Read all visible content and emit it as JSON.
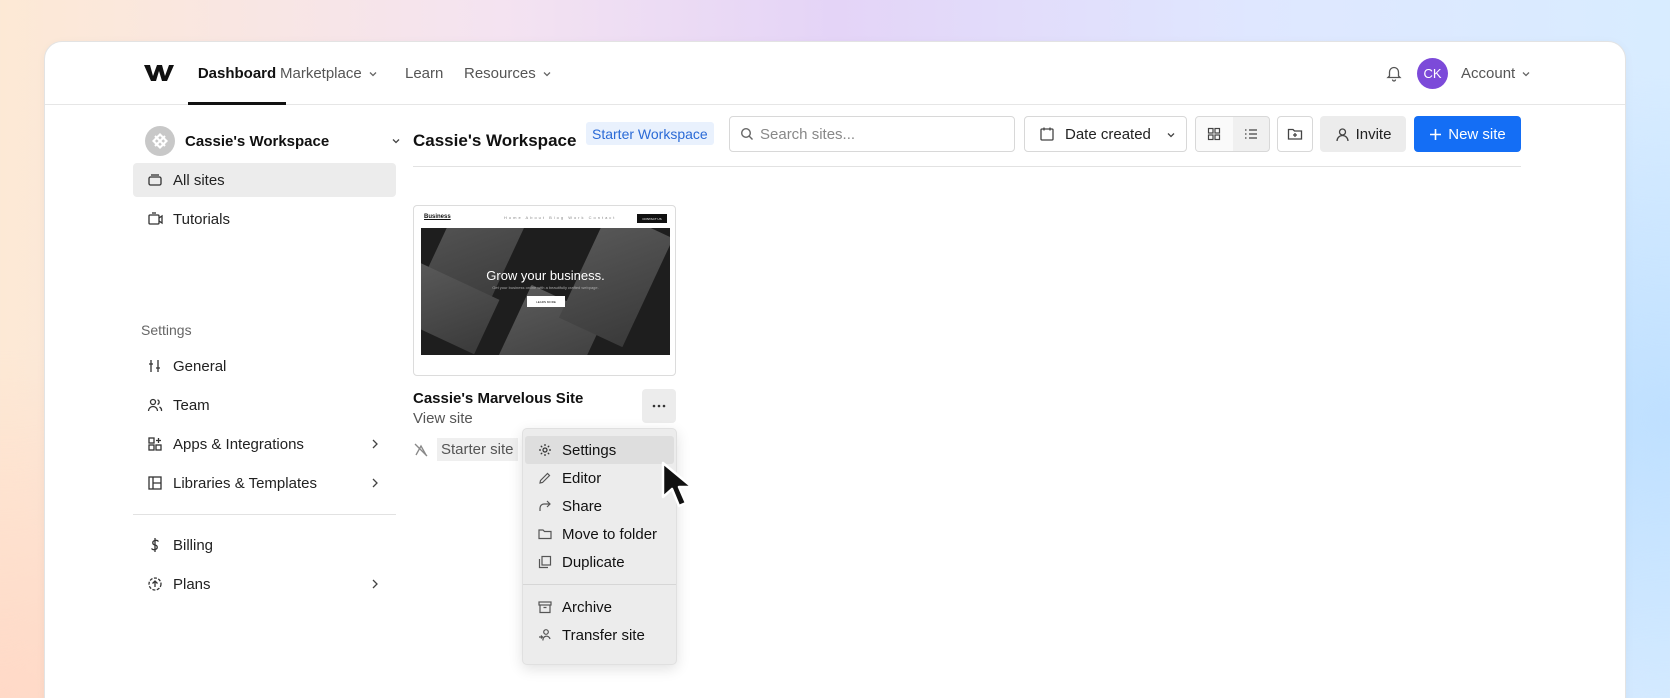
{
  "nav": {
    "dashboard": "Dashboard",
    "marketplace": "Marketplace",
    "learn": "Learn",
    "resources": "Resources",
    "avatar_initials": "CK",
    "account": "Account"
  },
  "sidebar": {
    "workspace_name": "Cassie's Workspace",
    "items": {
      "all_sites": "All sites",
      "tutorials": "Tutorials",
      "settings_heading": "Settings",
      "general": "General",
      "team": "Team",
      "apps": "Apps & Integrations",
      "libraries": "Libraries & Templates",
      "billing": "Billing",
      "plans": "Plans"
    }
  },
  "main": {
    "title": "Cassie's Workspace",
    "badge": "Starter Workspace",
    "search_placeholder": "Search sites...",
    "sort_label": "Date created",
    "invite": "Invite",
    "new_site": "New site"
  },
  "site": {
    "name": "Cassie's Marvelous Site",
    "view_site": "View site",
    "plan": "Starter site",
    "thumbnail": {
      "brand": "Business",
      "links": "Home About Blog Work Contact",
      "cta": "CONTACT US",
      "headline": "Grow your business.",
      "subtext": "Get your business online with a beautifully crafted webpage.",
      "button": "LEARN MORE"
    }
  },
  "menu": {
    "settings": "Settings",
    "editor": "Editor",
    "share": "Share",
    "move": "Move to folder",
    "duplicate": "Duplicate",
    "archive": "Archive",
    "transfer": "Transfer site"
  },
  "colors": {
    "accent": "#146ef5",
    "avatar": "#7c4ad9",
    "badge_text": "#2a6ad6"
  }
}
